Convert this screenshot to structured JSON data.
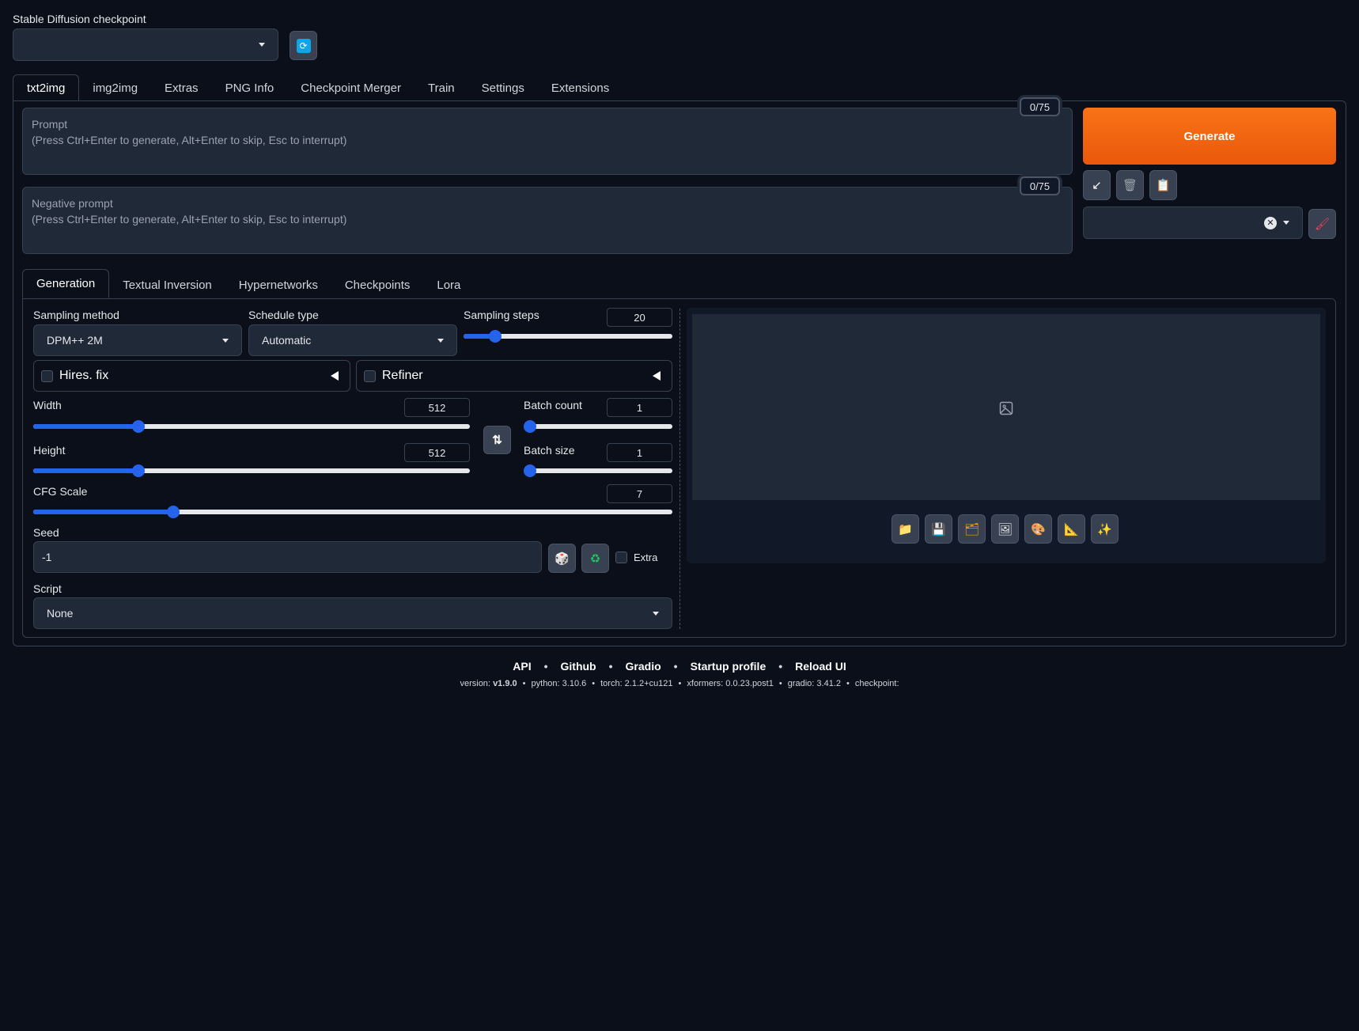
{
  "checkpoint": {
    "label": "Stable Diffusion checkpoint",
    "value": "",
    "refresh_icon": "refresh-icon"
  },
  "main_tabs": [
    "txt2img",
    "img2img",
    "Extras",
    "PNG Info",
    "Checkpoint Merger",
    "Train",
    "Settings",
    "Extensions"
  ],
  "prompt": {
    "placeholder_line1": "Prompt",
    "placeholder_line2": "(Press Ctrl+Enter to generate, Alt+Enter to skip, Esc to interrupt)",
    "counter": "0/75"
  },
  "negative_prompt": {
    "placeholder_line1": "Negative prompt",
    "placeholder_line2": "(Press Ctrl+Enter to generate, Alt+Enter to skip, Esc to interrupt)",
    "counter": "0/75"
  },
  "generate": {
    "label": "Generate",
    "color": "#f97316"
  },
  "tool_buttons": [
    "arrow-icon",
    "trash-icon",
    "clipboard-icon"
  ],
  "styles_dropdown": {
    "value": ""
  },
  "sub_tabs": [
    "Generation",
    "Textual Inversion",
    "Hypernetworks",
    "Checkpoints",
    "Lora"
  ],
  "generation": {
    "sampling_method": {
      "label": "Sampling method",
      "value": "DPM++ 2M"
    },
    "schedule_type": {
      "label": "Schedule type",
      "value": "Automatic"
    },
    "sampling_steps": {
      "label": "Sampling steps",
      "value": "20",
      "fraction": 0.13
    },
    "hires_fix": {
      "label": "Hires. fix",
      "checked": false
    },
    "refiner": {
      "label": "Refiner",
      "checked": false
    },
    "width": {
      "label": "Width",
      "value": "512",
      "fraction": 0.233
    },
    "height": {
      "label": "Height",
      "value": "512",
      "fraction": 0.233
    },
    "batch_count": {
      "label": "Batch count",
      "value": "1",
      "fraction": 0.0
    },
    "batch_size": {
      "label": "Batch size",
      "value": "1",
      "fraction": 0.0
    },
    "cfg_scale": {
      "label": "CFG Scale",
      "value": "7",
      "fraction": 0.214
    },
    "seed": {
      "label": "Seed",
      "value": "-1",
      "extra_label": "Extra"
    },
    "script": {
      "label": "Script",
      "value": "None"
    }
  },
  "output_buttons": [
    "folder-icon",
    "save-icon",
    "zip-icon",
    "image-icon",
    "palette-icon",
    "ruler-icon",
    "sparkle-icon"
  ],
  "footer": {
    "links": [
      "API",
      "Github",
      "Gradio",
      "Startup profile",
      "Reload UI"
    ],
    "version_label": "version:",
    "version_value": "v1.9.0",
    "python": "python: 3.10.6",
    "torch": "torch: 2.1.2+cu121",
    "xformers": "xformers: 0.0.23.post1",
    "gradio": "gradio: 3.41.2",
    "checkpoint": "checkpoint:"
  }
}
